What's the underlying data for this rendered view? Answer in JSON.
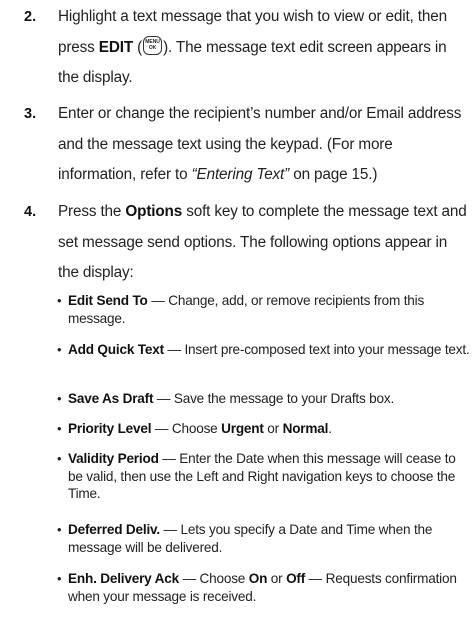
{
  "steps": [
    {
      "number": "2.",
      "parts": {
        "a": "Highlight a text message that you wish to view or edit, then press ",
        "b_edit": "EDIT",
        "c": " (",
        "d": "). The message text edit screen appears in the display."
      },
      "key_icon": {
        "name": "menu-ok-key-icon",
        "line1": "MENU",
        "line2": "OK"
      }
    },
    {
      "number": "3.",
      "parts": {
        "a": "Enter or change the recipient’s number and/or Email address and the message text using the keypad. (For more information, refer to ",
        "b_italic": "“Entering Text”",
        "c": " on page 15.)"
      }
    },
    {
      "number": "4.",
      "parts": {
        "a": "Press the ",
        "b_options": "Options",
        "c": " soft key to complete the message text and set message send options. The following options appear in the display:"
      }
    }
  ],
  "options": [
    {
      "label": "Edit Send To",
      "desc": " — Change, add, or remove recipients from this message."
    },
    {
      "label": "Add Quick Text",
      "desc": " — Insert pre-composed text into your message text."
    },
    {
      "label": "Save As Draft",
      "desc": " — Save the message to your Drafts box."
    },
    {
      "label": "Priority Level",
      "desc_a": " — Choose ",
      "opt1": "Urgent",
      "desc_b": " or ",
      "opt2": "Normal",
      "desc_c": "."
    },
    {
      "label": "Validity Period",
      "desc": " — Enter the Date when this message will cease to be valid, then use the Left and Right navigation keys to choose the Time."
    },
    {
      "label": "Deferred Deliv.",
      "desc": " — Lets you specify a Date and Time when the message will be delivered."
    },
    {
      "label": "Enh. Delivery Ack",
      "desc_a": " — Choose ",
      "opt1": "On",
      "desc_b": " or ",
      "opt2": "Off",
      "desc_c": " — Requests confirmation when your message is received."
    }
  ],
  "bullet_char": "•"
}
